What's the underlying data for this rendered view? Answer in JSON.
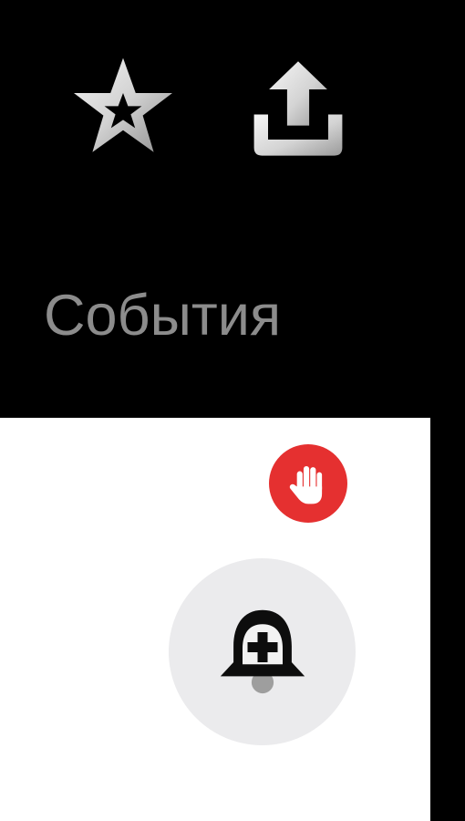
{
  "toolbar": {
    "favorite_icon": "star-icon",
    "share_icon": "share-upload-icon"
  },
  "section": {
    "title": "События"
  },
  "controls": {
    "block_icon": "hand-stop-icon",
    "subscribe_icon": "bell-plus-icon"
  },
  "colors": {
    "background": "#000000",
    "panel": "#ffffff",
    "title_text": "#8c8c8c",
    "badge_red": "#e53030",
    "bell_circle": "#ebebed"
  }
}
